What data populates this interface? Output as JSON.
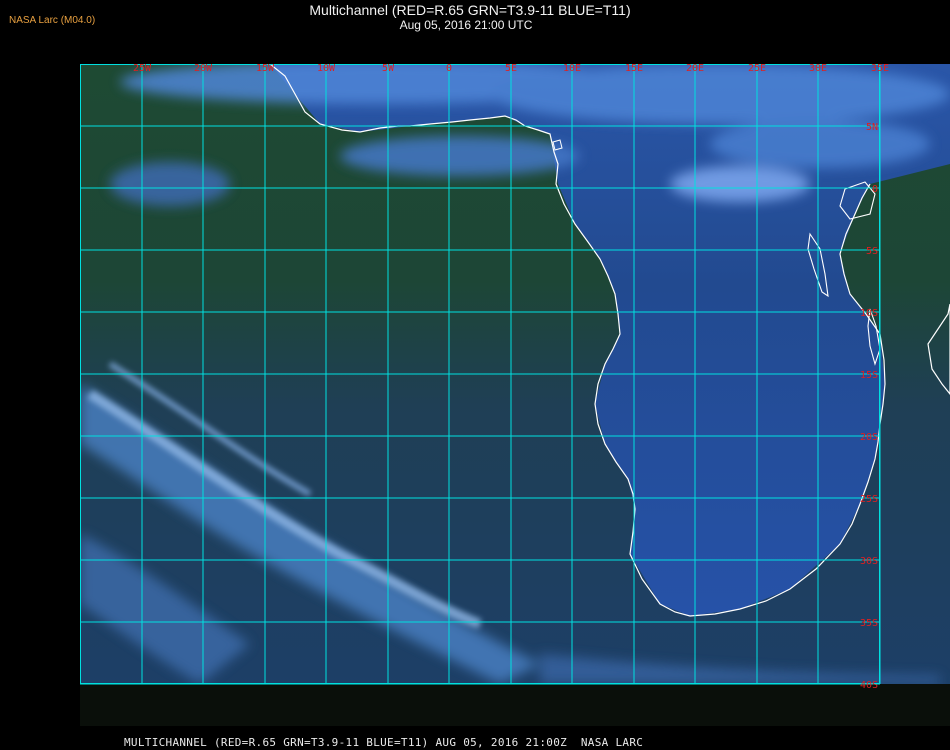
{
  "header": {
    "brand": "NASA Larc (M04.0)",
    "title": "Multichannel (RED=R.65 GRN=T3.9-11 BLUE=T11)",
    "subtitle": "Aug 05, 2016 21:00 UTC"
  },
  "footer": {
    "caption": "MULTICHANNEL (RED=R.65 GRN=T3.9-11 BLUE=T11) AUG 05, 2016 21:00Z  NASA LARC"
  },
  "map": {
    "projection": "lat-lon",
    "lon_range": [
      -28,
      35
    ],
    "lat_range": [
      -40,
      10
    ],
    "lon_labels": [
      "25W",
      "20W",
      "15W",
      "10W",
      "5W",
      "0",
      "5E",
      "10E",
      "15E",
      "20E",
      "25E",
      "30E",
      "35E"
    ],
    "lat_labels": [
      "5N",
      "0",
      "5S",
      "10S",
      "15S",
      "20S",
      "25S",
      "30S",
      "35S",
      "40S"
    ],
    "colors": {
      "grid": "#00e0e0",
      "label": "#e02020",
      "coastline": "#ffffff",
      "ocean": "#1c3a2a",
      "land": "#20407a",
      "cloud": "#5a8cd0",
      "brand": "#e8a040"
    }
  }
}
